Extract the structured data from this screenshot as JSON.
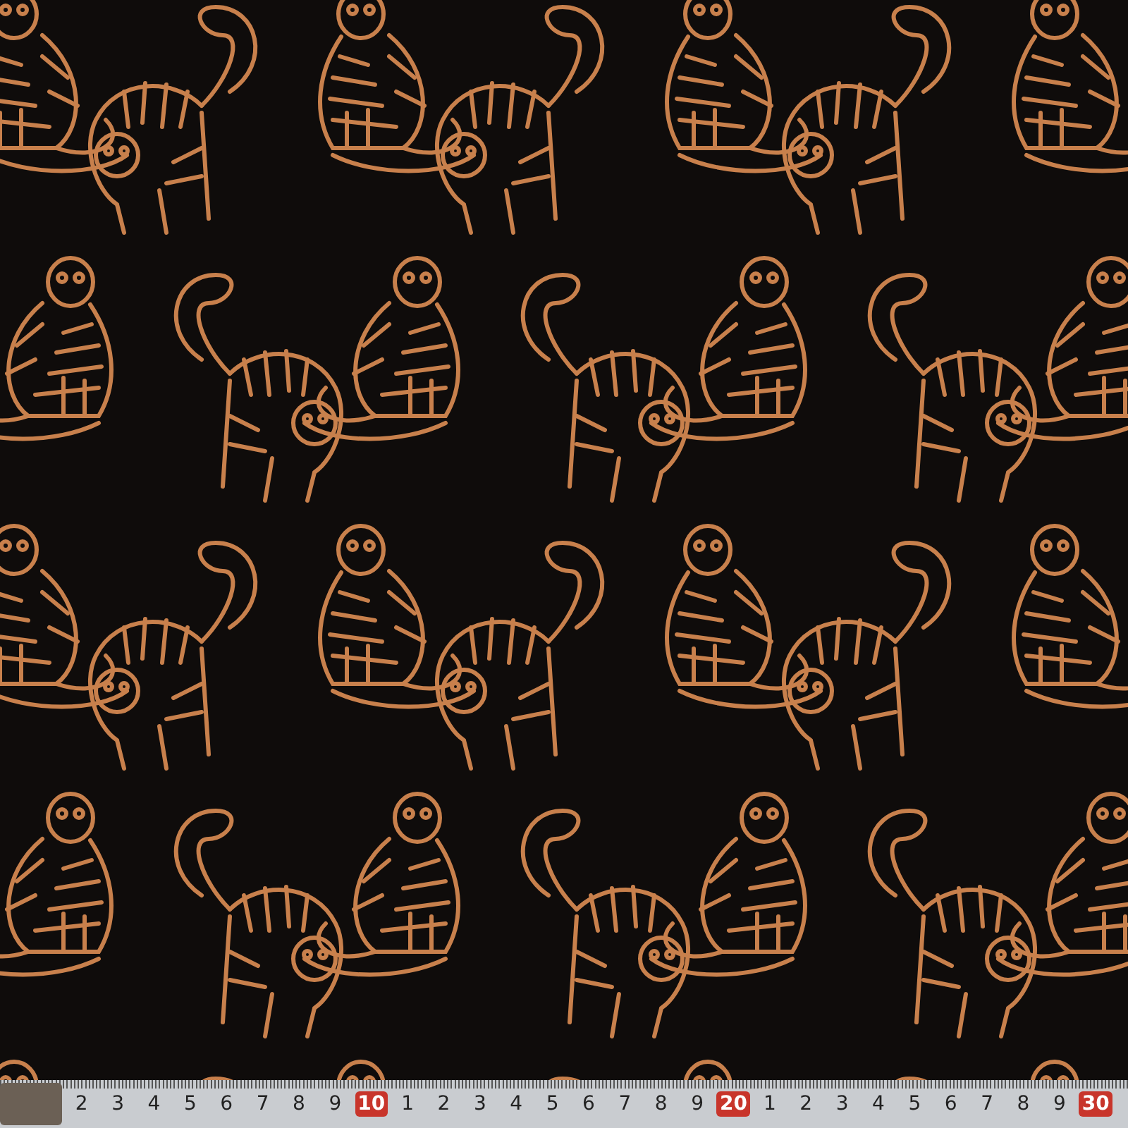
{
  "ruler": {
    "labels": [
      {
        "text": "2",
        "kind": "plain"
      },
      {
        "text": "3",
        "kind": "plain"
      },
      {
        "text": "4",
        "kind": "plain"
      },
      {
        "text": "5",
        "kind": "plain"
      },
      {
        "text": "6",
        "kind": "plain"
      },
      {
        "text": "7",
        "kind": "plain"
      },
      {
        "text": "8",
        "kind": "plain"
      },
      {
        "text": "9",
        "kind": "plain"
      },
      {
        "text": "10",
        "kind": "boxed"
      },
      {
        "text": "1",
        "kind": "plain"
      },
      {
        "text": "2",
        "kind": "plain"
      },
      {
        "text": "3",
        "kind": "plain"
      },
      {
        "text": "4",
        "kind": "plain"
      },
      {
        "text": "5",
        "kind": "plain"
      },
      {
        "text": "6",
        "kind": "plain"
      },
      {
        "text": "7",
        "kind": "plain"
      },
      {
        "text": "8",
        "kind": "plain"
      },
      {
        "text": "9",
        "kind": "plain"
      },
      {
        "text": "20",
        "kind": "boxed"
      },
      {
        "text": "1",
        "kind": "plain"
      },
      {
        "text": "2",
        "kind": "plain"
      },
      {
        "text": "3",
        "kind": "plain"
      },
      {
        "text": "4",
        "kind": "plain"
      },
      {
        "text": "5",
        "kind": "plain"
      },
      {
        "text": "6",
        "kind": "plain"
      },
      {
        "text": "7",
        "kind": "plain"
      },
      {
        "text": "8",
        "kind": "plain"
      },
      {
        "text": "9",
        "kind": "plain"
      },
      {
        "text": "30",
        "kind": "boxed"
      }
    ]
  }
}
